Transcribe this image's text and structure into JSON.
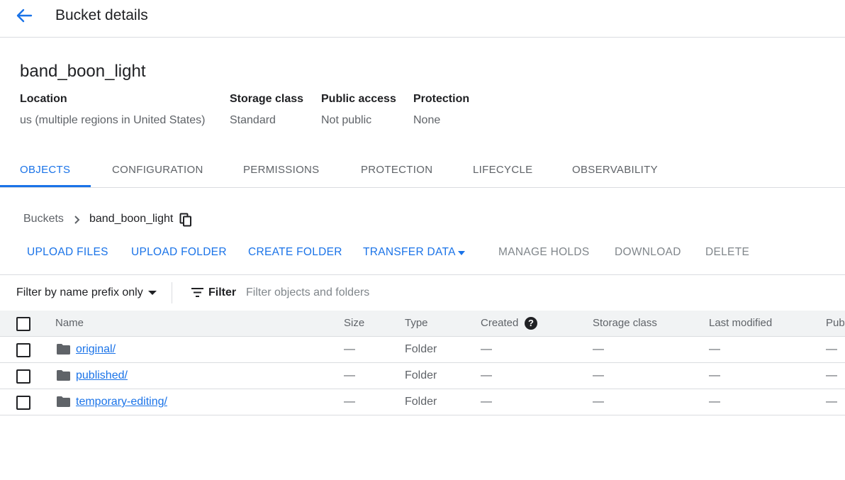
{
  "header": {
    "title": "Bucket details"
  },
  "bucket": {
    "name": "band_boon_light",
    "meta": [
      {
        "label": "Location",
        "value": "us (multiple regions in United States)"
      },
      {
        "label": "Storage class",
        "value": "Standard"
      },
      {
        "label": "Public access",
        "value": "Not public"
      },
      {
        "label": "Protection",
        "value": "None"
      }
    ]
  },
  "tabs": [
    "OBJECTS",
    "CONFIGURATION",
    "PERMISSIONS",
    "PROTECTION",
    "LIFECYCLE",
    "OBSERVABILITY"
  ],
  "active_tab": "OBJECTS",
  "breadcrumb": {
    "root": "Buckets",
    "current": "band_boon_light"
  },
  "actions": {
    "upload_files": "UPLOAD FILES",
    "upload_folder": "UPLOAD FOLDER",
    "create_folder": "CREATE FOLDER",
    "transfer_data": "TRANSFER DATA",
    "manage_holds": "MANAGE HOLDS",
    "download": "DOWNLOAD",
    "delete": "DELETE"
  },
  "filter": {
    "mode": "Filter by name prefix only",
    "label": "Filter",
    "placeholder": "Filter objects and folders"
  },
  "table": {
    "columns": [
      "Name",
      "Size",
      "Type",
      "Created",
      "Storage class",
      "Last modified",
      "Pub"
    ],
    "rows": [
      {
        "name": "original/",
        "size": "—",
        "type": "Folder",
        "created": "—",
        "storage_class": "—",
        "last_modified": "—",
        "public": "—"
      },
      {
        "name": "published/",
        "size": "—",
        "type": "Folder",
        "created": "—",
        "storage_class": "—",
        "last_modified": "—",
        "public": "—"
      },
      {
        "name": "temporary-editing/",
        "size": "—",
        "type": "Folder",
        "created": "—",
        "storage_class": "—",
        "last_modified": "—",
        "public": "—"
      }
    ]
  },
  "icons": {
    "back": "arrow-back-icon",
    "copy": "copy-icon",
    "filter": "filter-list-icon",
    "help": "help-icon",
    "folder": "folder-icon"
  },
  "colors": {
    "accent": "#1a73e8",
    "text": "#202124",
    "muted": "#5f6368",
    "border": "#dadce0"
  }
}
